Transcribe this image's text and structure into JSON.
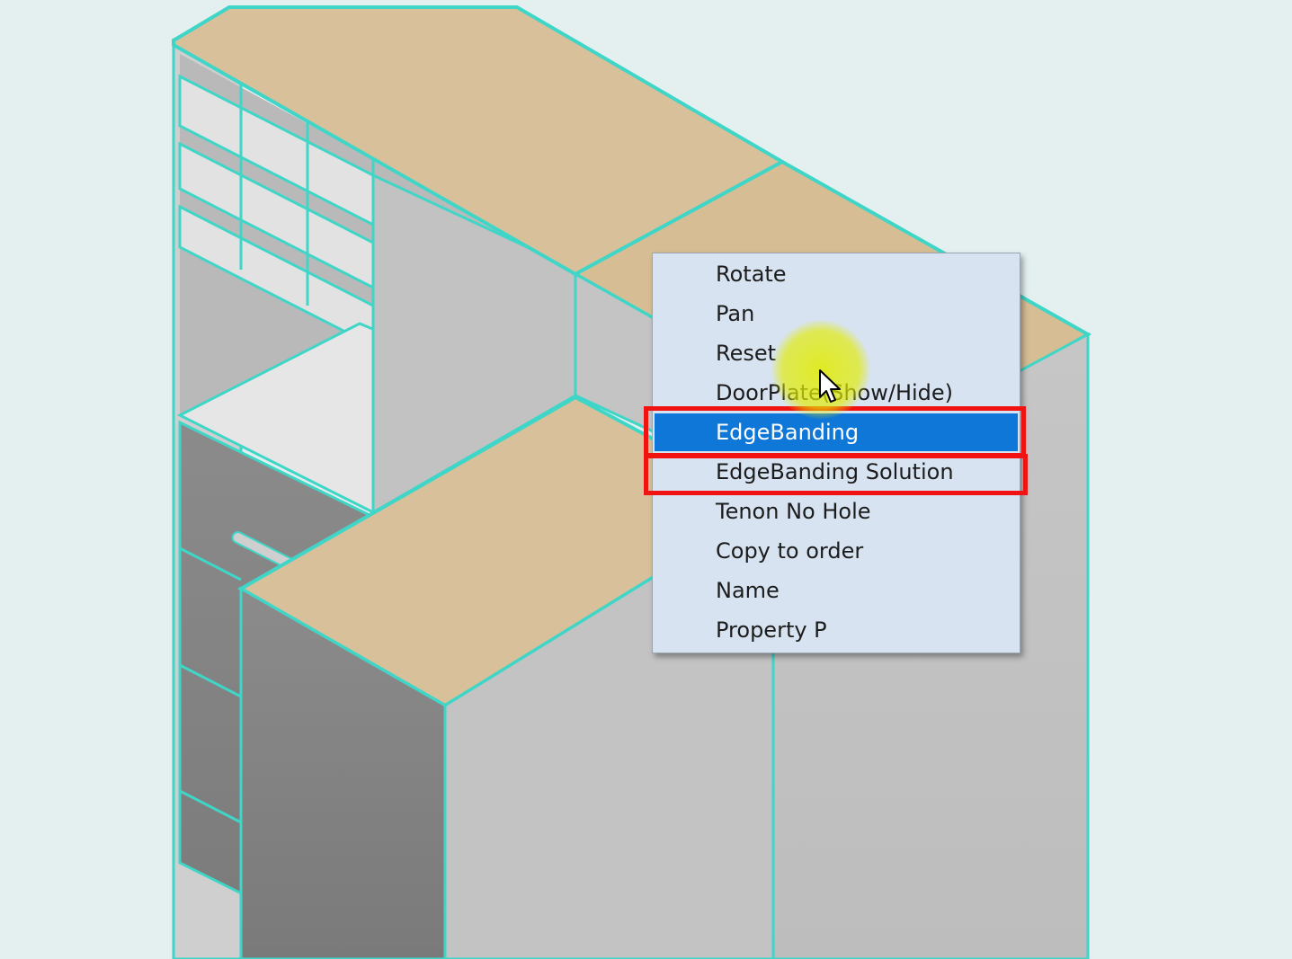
{
  "context_menu": {
    "items": [
      {
        "label": "Rotate"
      },
      {
        "label": "Pan"
      },
      {
        "label": "Reset"
      },
      {
        "label": "DoorPlate(Show/Hide)"
      },
      {
        "label": "EdgeBanding",
        "state": "hovered"
      },
      {
        "label": "EdgeBanding Solution"
      },
      {
        "label": "Tenon No Hole"
      },
      {
        "label": "Copy to order"
      },
      {
        "label": "Name"
      },
      {
        "label": "Property P"
      }
    ]
  },
  "highlights": [
    {
      "target": "EdgeBanding",
      "color": "#f11212"
    },
    {
      "target": "EdgeBanding Solution",
      "color": "#f11212"
    }
  ],
  "colors": {
    "background": "#e4efef",
    "wood_top": "#d8c09a",
    "panel_light": "#c9c9c9",
    "panel_dark": "#808080",
    "edge_outline": "#3fd6c8",
    "menu_background": "#d7e3f1",
    "menu_active": "#0f77d7"
  },
  "cursor": {
    "icon": "arrow-cursor-icon",
    "click_indicator": "yellow-circle"
  }
}
